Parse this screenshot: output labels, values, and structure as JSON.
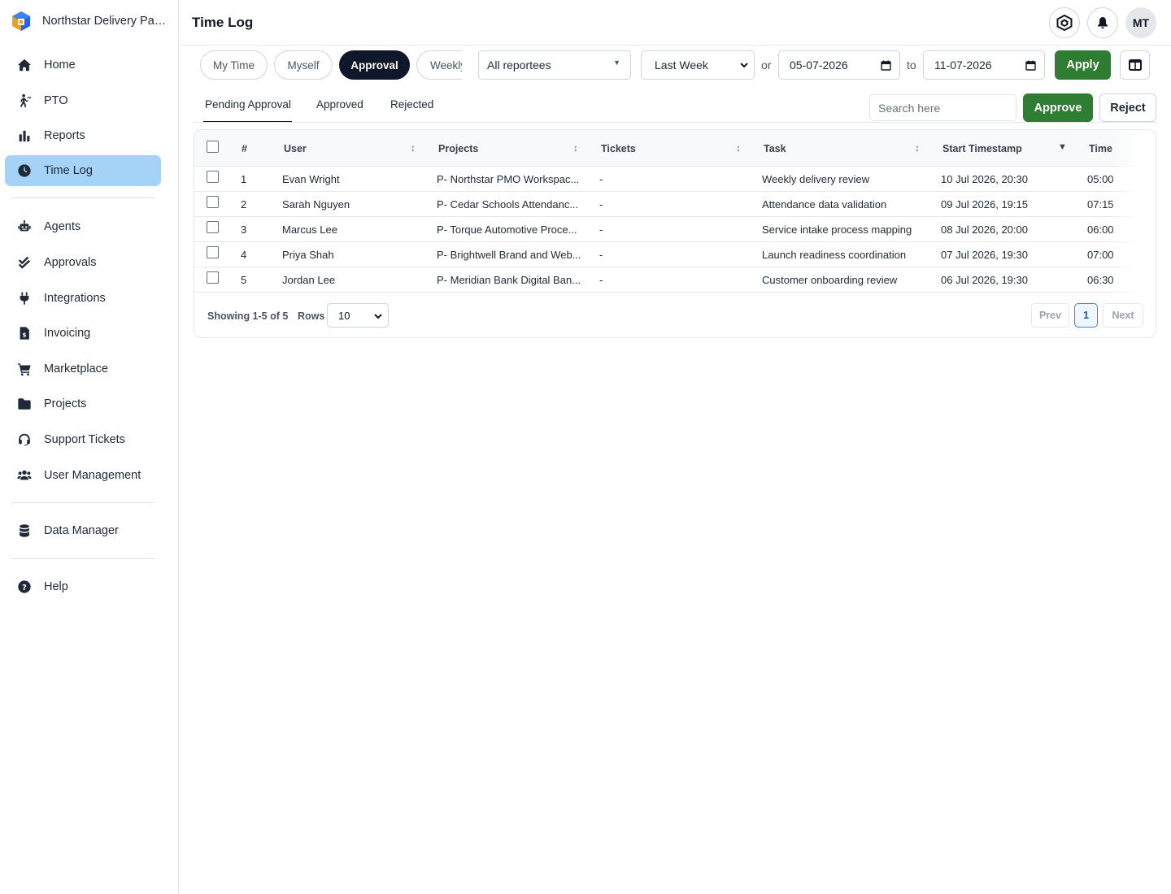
{
  "brand": {
    "name": "Northstar Delivery Partners"
  },
  "sidebar": {
    "items": [
      {
        "label": "Home",
        "icon": "home-icon"
      },
      {
        "label": "PTO",
        "icon": "walk-icon"
      },
      {
        "label": "Reports",
        "icon": "bar-chart-icon"
      },
      {
        "label": "Time Log",
        "icon": "clock-icon",
        "active": true
      },
      {
        "label": "Agents",
        "icon": "robot-icon"
      },
      {
        "label": "Approvals",
        "icon": "check-double-icon"
      },
      {
        "label": "Integrations",
        "icon": "plug-icon"
      },
      {
        "label": "Invoicing",
        "icon": "invoice-icon"
      },
      {
        "label": "Marketplace",
        "icon": "cart-icon"
      },
      {
        "label": "Projects",
        "icon": "folder-icon"
      },
      {
        "label": "Support Tickets",
        "icon": "headset-icon"
      },
      {
        "label": "User Management",
        "icon": "users-icon"
      },
      {
        "label": "Data Manager",
        "icon": "database-icon"
      },
      {
        "label": "Help",
        "icon": "help-icon"
      }
    ]
  },
  "header": {
    "title": "Time Log",
    "avatar": "MT"
  },
  "toolbar": {
    "views": [
      "My Time",
      "Myself",
      "Approval",
      "Weekly"
    ],
    "active_view": "Approval",
    "reportees": "All reportees",
    "range": "Last Week",
    "or_label": "or",
    "from_date": "05-07-2026",
    "to_label": "to",
    "to_date": "11-07-2026",
    "apply_label": "Apply"
  },
  "tabs": {
    "items": [
      "Pending Approval",
      "Approved",
      "Rejected"
    ],
    "active": "Pending Approval",
    "search_placeholder": "Search here",
    "approve_label": "Approve",
    "reject_label": "Reject"
  },
  "table": {
    "columns": [
      "#",
      "User",
      "Projects",
      "Tickets",
      "Task",
      "Start Timestamp",
      "Time"
    ],
    "rows": [
      {
        "n": "1",
        "user": "Evan Wright",
        "project": "P- Northstar PMO Workspac...",
        "ticket": "-",
        "task": "Weekly delivery review",
        "start": "10 Jul 2026, 20:30",
        "time": "05:00"
      },
      {
        "n": "2",
        "user": "Sarah Nguyen",
        "project": "P- Cedar Schools Attendanc...",
        "ticket": "-",
        "task": "Attendance data validation",
        "start": "09 Jul 2026, 19:15",
        "time": "07:15"
      },
      {
        "n": "3",
        "user": "Marcus Lee",
        "project": "P- Torque Automotive Proce...",
        "ticket": "-",
        "task": "Service intake process mapping",
        "start": "08 Jul 2026, 20:00",
        "time": "06:00"
      },
      {
        "n": "4",
        "user": "Priya Shah",
        "project": "P- Brightwell Brand and Web...",
        "ticket": "-",
        "task": "Launch readiness coordination",
        "start": "07 Jul 2026, 19:30",
        "time": "07:00"
      },
      {
        "n": "5",
        "user": "Jordan Lee",
        "project": "P- Meridian Bank Digital Ban...",
        "ticket": "-",
        "task": "Customer onboarding review",
        "start": "06 Jul 2026, 19:30",
        "time": "06:30"
      }
    ],
    "showing": "Showing 1-5 of 5",
    "rows_label": "Rows",
    "rows_per_page": "10",
    "prev_label": "Prev",
    "page": "1",
    "next_label": "Next"
  },
  "colors": {
    "accent_green": "#2e7d32",
    "active_nav": "#a5d3f7",
    "dark_pill": "#0f172a"
  }
}
